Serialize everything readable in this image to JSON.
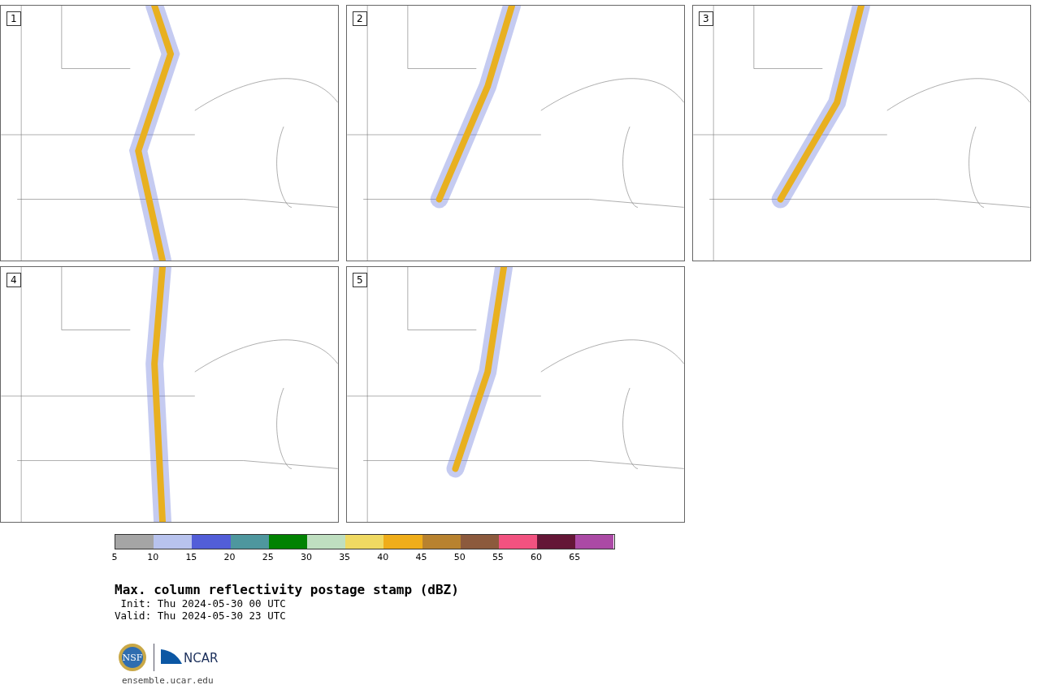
{
  "panels": [
    {
      "label": "1"
    },
    {
      "label": "2"
    },
    {
      "label": "3"
    },
    {
      "label": "4"
    },
    {
      "label": "5"
    }
  ],
  "colorbar": [
    {
      "label": "5",
      "color": "#a5a5a5"
    },
    {
      "label": "10",
      "color": "#b8c3ee"
    },
    {
      "label": "15",
      "color": "#525ed8"
    },
    {
      "label": "20",
      "color": "#4e979e"
    },
    {
      "label": "25",
      "color": "#018202"
    },
    {
      "label": "30",
      "color": "#bfdfc0"
    },
    {
      "label": "35",
      "color": "#efd962"
    },
    {
      "label": "40",
      "color": "#efad1a"
    },
    {
      "label": "45",
      "color": "#b8822f"
    },
    {
      "label": "50",
      "color": "#8c5a3d"
    },
    {
      "label": "55",
      "color": "#f25280"
    },
    {
      "label": "60",
      "color": "#641636"
    },
    {
      "label": "65",
      "color": "#ab4aa5"
    }
  ],
  "title": "Max. column reflectivity postage stamp (dBZ)",
  "init": " Init: Thu 2024-05-30 00 UTC",
  "valid": "Valid: Thu 2024-05-30 23 UTC",
  "logo": {
    "nsf": "NSF",
    "ncar": "NCAR"
  },
  "footer": "ensemble.ucar.edu"
}
